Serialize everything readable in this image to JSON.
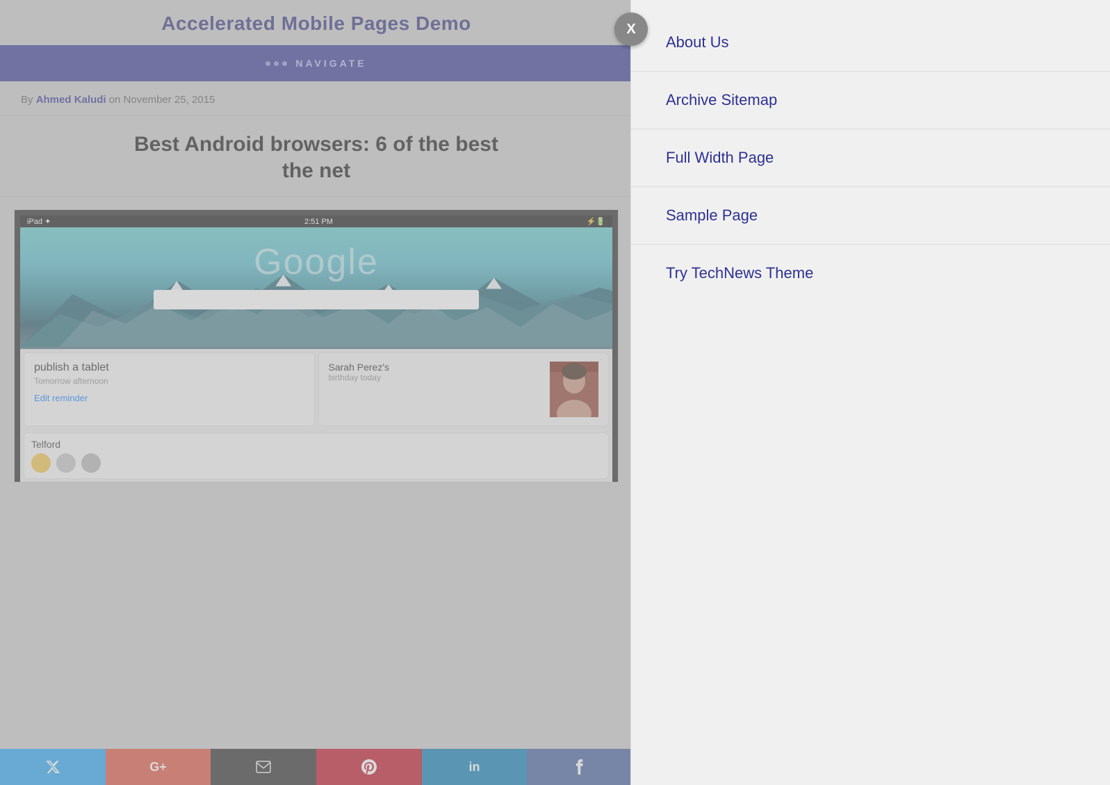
{
  "header": {
    "title": "Accelerated Mobile Pages Demo"
  },
  "navbar": {
    "dots_count": 3,
    "label": "NAVIGATE"
  },
  "article": {
    "author_prefix": "By ",
    "author_name": "Ahmed Kaludi",
    "author_date": " on November 25, 2015",
    "title_line1": "Best Android browsers: 6 of the best",
    "title_line2": "the net"
  },
  "ipad": {
    "status_left": "iPad ✦",
    "status_center": "2:51 PM",
    "google_text": "Google",
    "card1_title": "publish a tablet",
    "card1_subtitle": "Tomorrow afternoon",
    "card1_link": "Edit reminder",
    "card2_name": "Sarah Perez's",
    "card2_desc": "birthday today",
    "weather_city": "Telford"
  },
  "social": {
    "twitter": "𝕏",
    "googleplus": "G+",
    "email": "✉",
    "pinterest": "𝕡",
    "linkedin": "in",
    "facebook": "f"
  },
  "slide_panel": {
    "close_label": "X",
    "menu_items": [
      {
        "label": "About Us",
        "id": "about-us"
      },
      {
        "label": "Archive Sitemap",
        "id": "archive-sitemap"
      },
      {
        "label": "Full Width Page",
        "id": "full-width-page"
      },
      {
        "label": "Sample Page",
        "id": "sample-page"
      },
      {
        "label": "Try TechNews Theme",
        "id": "try-technews-theme"
      }
    ]
  }
}
